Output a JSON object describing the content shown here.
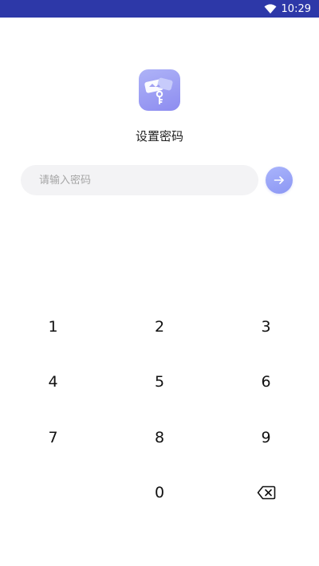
{
  "status_bar": {
    "time": "10:29",
    "icons": [
      "wifi-icon"
    ],
    "background": "#2d38a8"
  },
  "app": {
    "icon": "wallet-key-icon",
    "title": "设置密码"
  },
  "password": {
    "placeholder": "请输入密码",
    "value": ""
  },
  "submit": {
    "icon": "arrow-right-icon",
    "accent": "#97a2f7"
  },
  "keypad": {
    "keys": [
      "1",
      "2",
      "3",
      "4",
      "5",
      "6",
      "7",
      "8",
      "9",
      "",
      "0"
    ],
    "backspace_icon": "backspace-icon"
  }
}
